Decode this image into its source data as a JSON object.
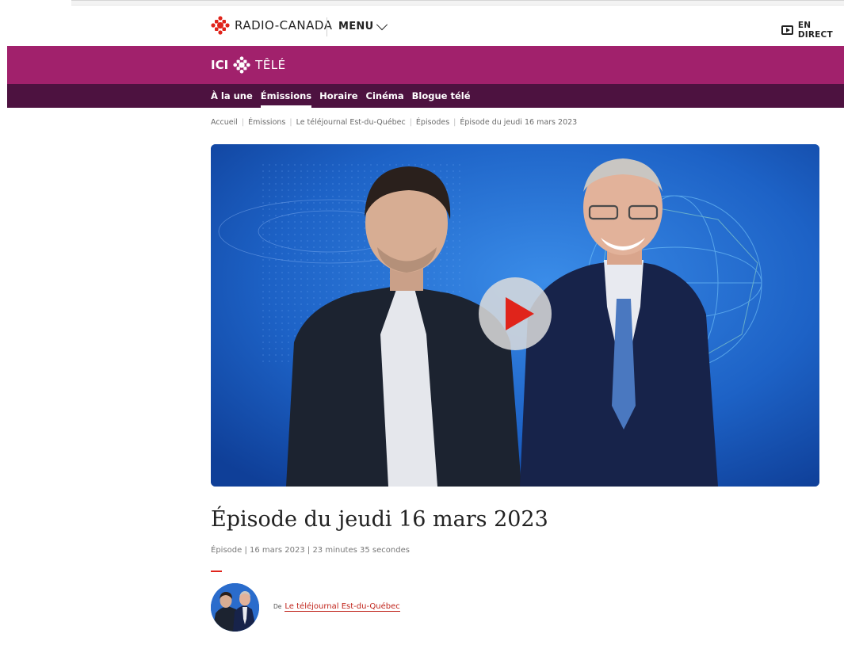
{
  "header": {
    "brand": "RADIO-CANADA",
    "menu_label": "MENU",
    "live_label": "EN DIRECT"
  },
  "banner": {
    "ici": "ICI",
    "tele": "TÊLÉ"
  },
  "nav": {
    "items": [
      {
        "label": "À la une",
        "active": false
      },
      {
        "label": "Émissions",
        "active": true
      },
      {
        "label": "Horaire",
        "active": false
      },
      {
        "label": "Cinéma",
        "active": false
      },
      {
        "label": "Blogue télé",
        "active": false
      }
    ]
  },
  "breadcrumb": [
    "Accueil",
    "Émissions",
    "Le téléjournal Est-du-Québec",
    "Épisodes",
    "Épisode du jeudi 16 mars 2023"
  ],
  "episode": {
    "title": "Épisode du jeudi 16 mars 2023",
    "meta": "Épisode | 16 mars 2023 | 23 minutes 35 secondes",
    "by_prefix": "De",
    "show_link": "Le téléjournal Est-du-Québec"
  },
  "colors": {
    "banner": "#a1216c",
    "nav": "#4d1240",
    "accent": "#e0241b",
    "hero_bg": "#1f64c4"
  },
  "icons": {
    "brand": "radio-canada-gem-icon",
    "menu": "chevron-down-icon",
    "live": "tv-play-icon",
    "play": "play-icon"
  }
}
